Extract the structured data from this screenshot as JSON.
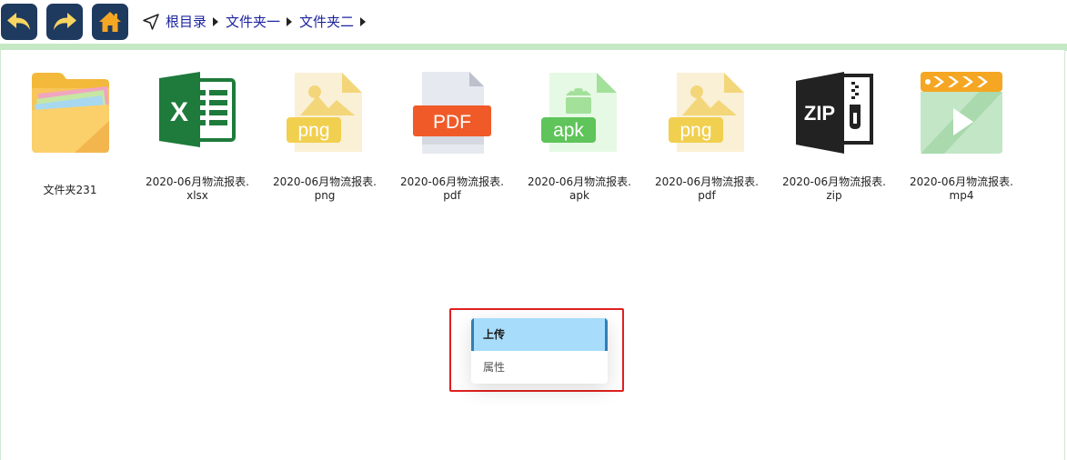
{
  "toolbar": {
    "back_icon": "undo-arrow-icon",
    "forward_icon": "redo-arrow-icon",
    "home_icon": "home-icon",
    "button_color": "#1f3a5f",
    "home_color": "#f5a623"
  },
  "breadcrumb": {
    "icon": "navigation-arrow-icon",
    "items": [
      "根目录",
      "文件夹一",
      "文件夹二"
    ]
  },
  "files": [
    {
      "name": "文件夹231",
      "type": "folder",
      "icon": "folder-icon"
    },
    {
      "name": "2020-06月物流报表.xlsx",
      "type": "xlsx",
      "icon": "excel-icon"
    },
    {
      "name": "2020-06月物流报表.png",
      "type": "png",
      "icon": "png-image-icon",
      "badge": "png"
    },
    {
      "name": "2020-06月物流报表.pdf",
      "type": "pdf",
      "icon": "pdf-icon",
      "badge": "PDF"
    },
    {
      "name": "2020-06月物流报表.apk",
      "type": "apk",
      "icon": "apk-android-icon",
      "badge": "apk"
    },
    {
      "name": "2020-06月物流报表.pdf",
      "type": "pdf-image",
      "icon": "png-image-icon",
      "badge": "png"
    },
    {
      "name": "2020-06月物流报表.zip",
      "type": "zip",
      "icon": "zip-archive-icon",
      "badge": "ZIP"
    },
    {
      "name": "2020-06月物流报表.mp4",
      "type": "mp4",
      "icon": "video-play-icon"
    }
  ],
  "context_menu": {
    "items": [
      {
        "label": "上传",
        "active": true
      },
      {
        "label": "属性",
        "active": false
      }
    ],
    "highlight_color": "#e02020",
    "active_color": "#a7dcfb"
  }
}
